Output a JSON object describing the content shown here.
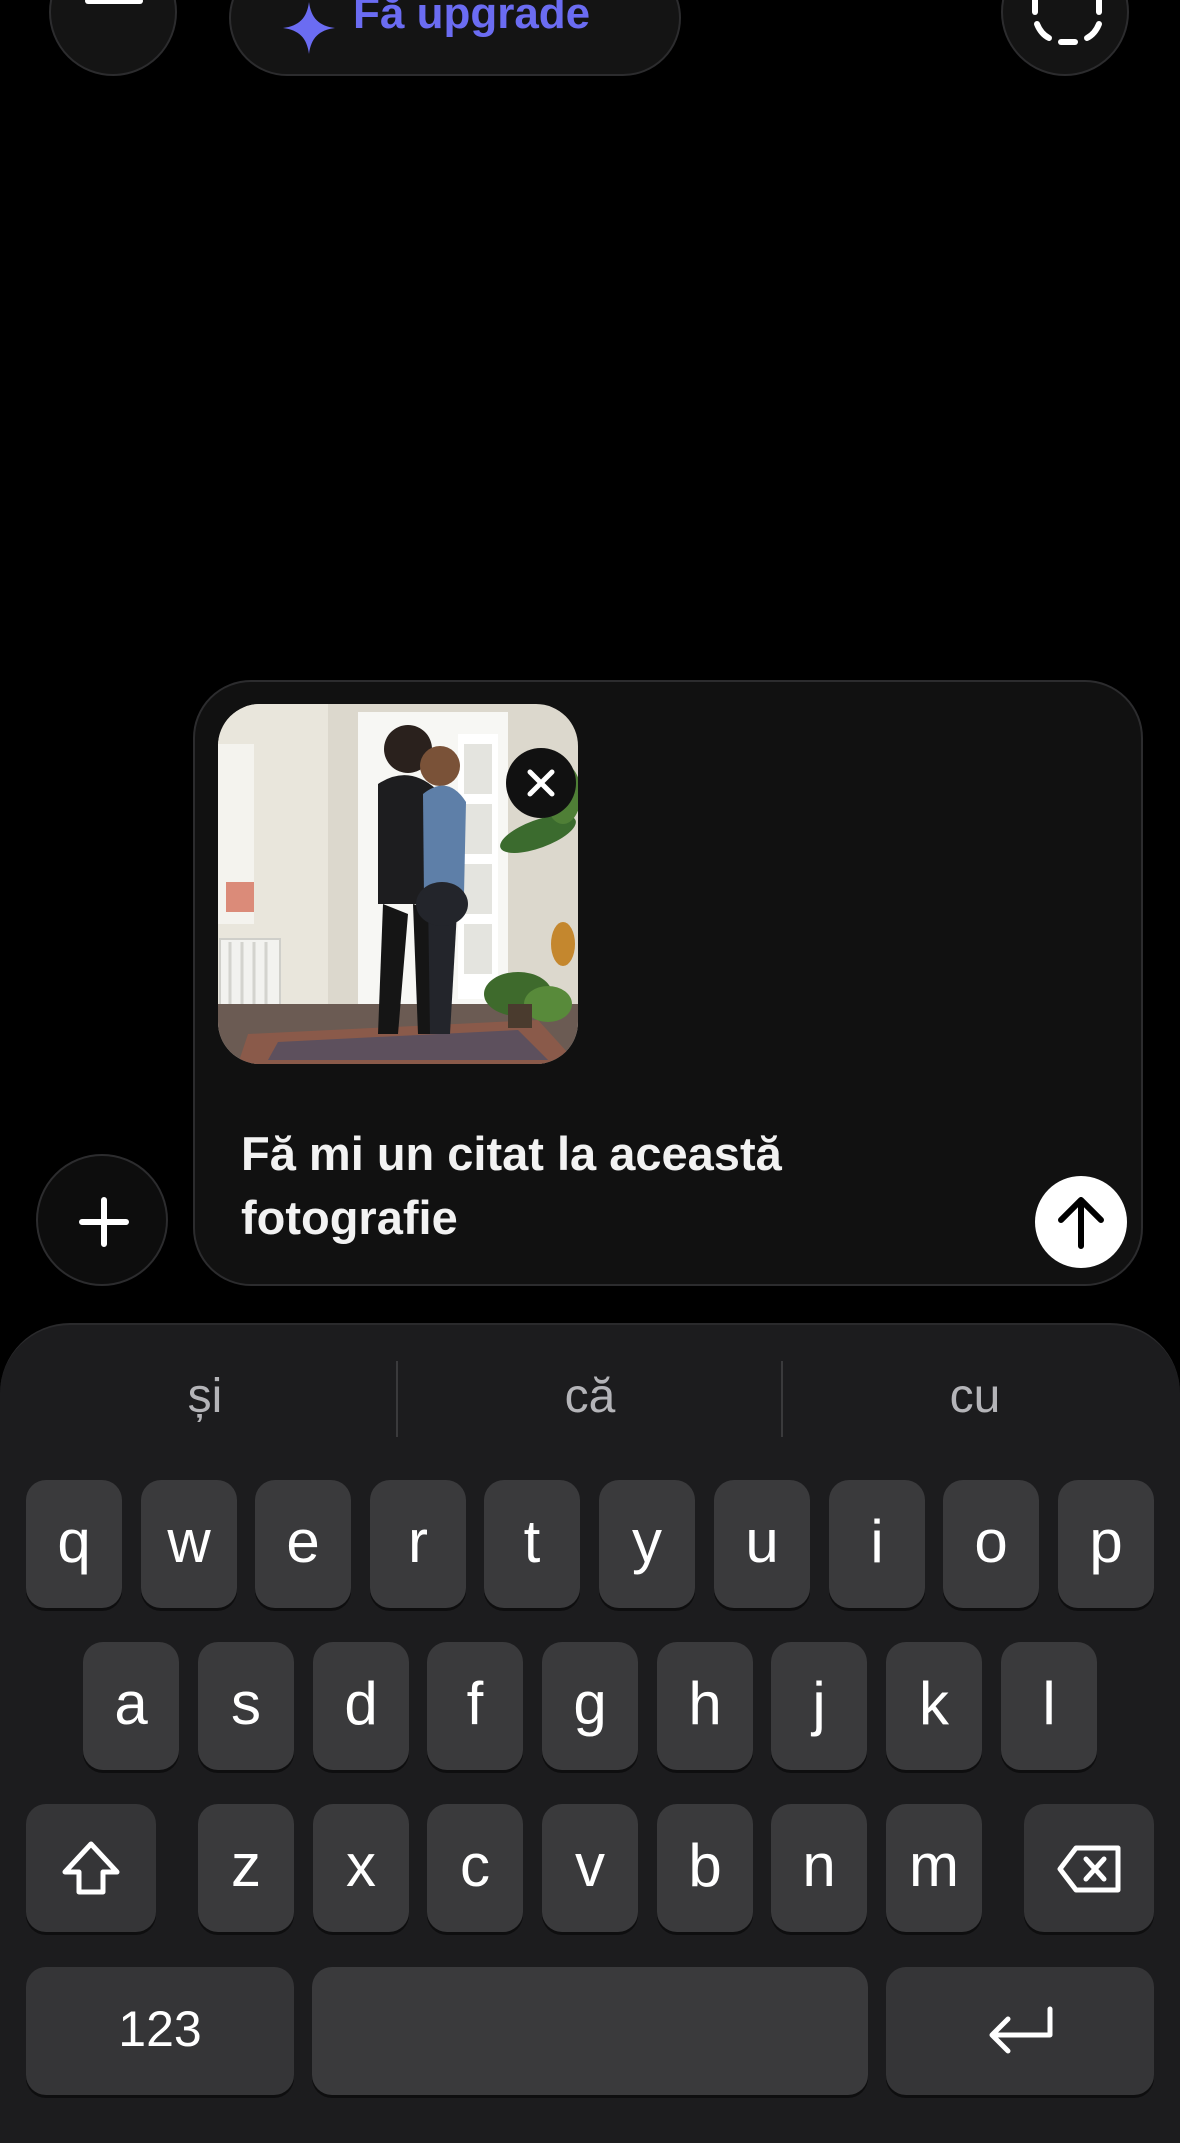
{
  "header": {
    "menu_icon": "hamburger-menu-icon",
    "upgrade_label": "Fă upgrade",
    "upgrade_icon": "sparkle-icon",
    "temporary_chat_icon": "dashed-chat-bubble-icon",
    "accent_color": "#6b6cf2"
  },
  "composer": {
    "attachment_icon": "plus-icon",
    "image_thumbnail": "photo-attachment",
    "remove_attachment_icon": "close-icon",
    "prompt_text": "Fă mi un citat la această fotografie",
    "send_icon": "arrow-up-icon"
  },
  "keyboard": {
    "suggestions": [
      "și",
      "că",
      "cu"
    ],
    "row1": [
      "q",
      "w",
      "e",
      "r",
      "t",
      "y",
      "u",
      "i",
      "o",
      "p"
    ],
    "row2": [
      "a",
      "s",
      "d",
      "f",
      "g",
      "h",
      "j",
      "k",
      "l"
    ],
    "row3": [
      "z",
      "x",
      "c",
      "v",
      "b",
      "n",
      "m"
    ],
    "shift_icon": "shift-arrow-icon",
    "delete_icon": "backspace-icon",
    "numbers_label": "123",
    "return_icon": "return-arrow-icon"
  }
}
